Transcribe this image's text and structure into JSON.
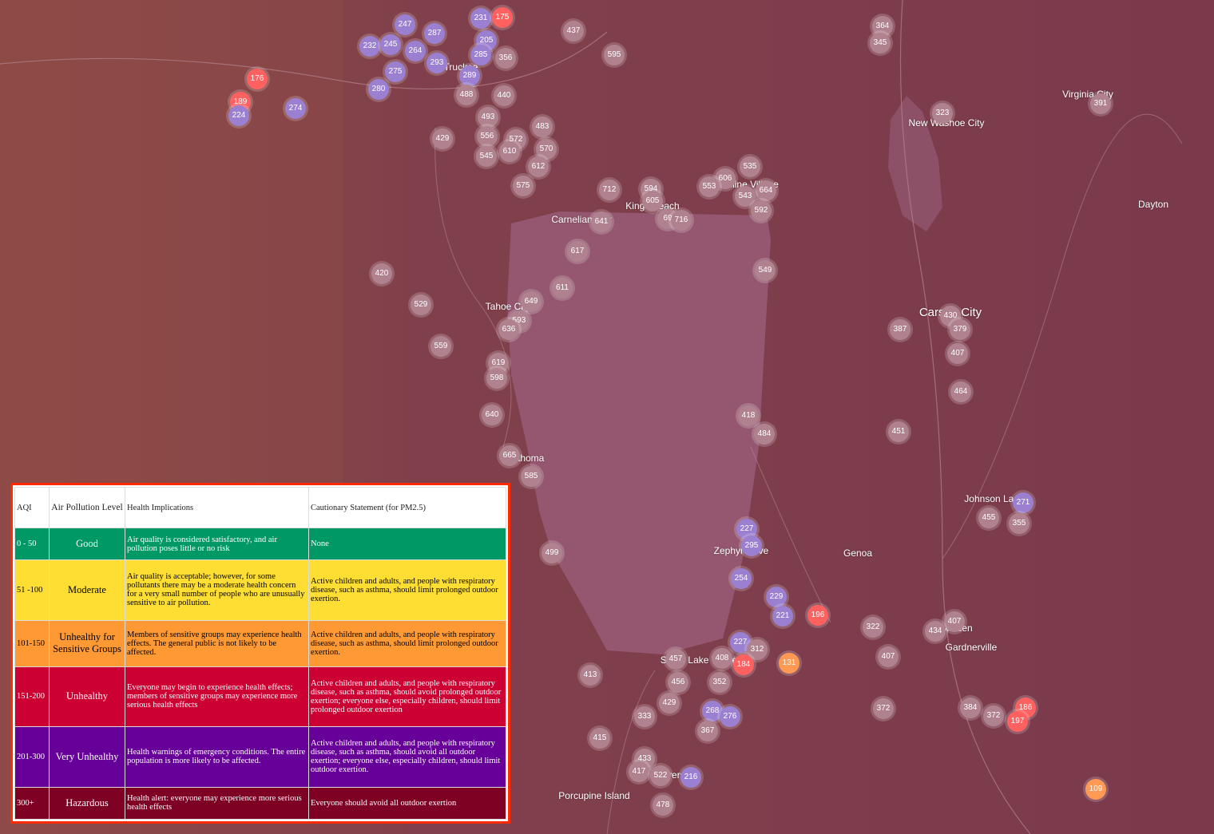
{
  "colors": {
    "bg": "#7a3a4c",
    "lake": "#94576f",
    "purple": "#9b7fd0",
    "mauve": "#b0828f",
    "red": "#ff6060",
    "orange": "#ff9a55"
  },
  "places": [
    {
      "label": "Truckee"
    },
    {
      "label": "Carnelian Bay"
    },
    {
      "label": "Kings Beach"
    },
    {
      "label": "Incline Village"
    },
    {
      "label": "Tahoe City"
    },
    {
      "label": "Tahoma"
    },
    {
      "label": "Zephyr Cove"
    },
    {
      "label": "South Lake Tahoe"
    },
    {
      "label": "Porcupine Island"
    },
    {
      "label": "Genoa"
    },
    {
      "label": "Gardnerville"
    },
    {
      "label": "Johnson Lane"
    },
    {
      "label": "Carson City"
    },
    {
      "label": "New Washoe City"
    },
    {
      "label": "Virginia City"
    },
    {
      "label": "Dayton"
    },
    {
      "label": "Minden"
    },
    {
      "label": "Meyers"
    }
  ],
  "markers": [
    {
      "v": "231",
      "c": "purple"
    },
    {
      "v": "175",
      "c": "red"
    },
    {
      "v": "247",
      "c": "purple"
    },
    {
      "v": "287",
      "c": "purple"
    },
    {
      "v": "205",
      "c": "purple"
    },
    {
      "v": "232",
      "c": "purple"
    },
    {
      "v": "245",
      "c": "purple"
    },
    {
      "v": "264",
      "c": "purple"
    },
    {
      "v": "293",
      "c": "purple"
    },
    {
      "v": "285",
      "c": "purple"
    },
    {
      "v": "356",
      "c": "mauve"
    },
    {
      "v": "437",
      "c": "mauve"
    },
    {
      "v": "595",
      "c": "mauve"
    },
    {
      "v": "275",
      "c": "purple"
    },
    {
      "v": "289",
      "c": "purple"
    },
    {
      "v": "176",
      "c": "red"
    },
    {
      "v": "280",
      "c": "purple"
    },
    {
      "v": "488",
      "c": "mauve"
    },
    {
      "v": "440",
      "c": "mauve"
    },
    {
      "v": "189",
      "c": "red"
    },
    {
      "v": "274",
      "c": "purple"
    },
    {
      "v": "224",
      "c": "purple"
    },
    {
      "v": "493",
      "c": "mauve"
    },
    {
      "v": "483",
      "c": "mauve"
    },
    {
      "v": "556",
      "c": "mauve"
    },
    {
      "v": "572",
      "c": "mauve"
    },
    {
      "v": "429",
      "c": "mauve"
    },
    {
      "v": "570",
      "c": "mauve"
    },
    {
      "v": "610",
      "c": "mauve"
    },
    {
      "v": "545",
      "c": "mauve"
    },
    {
      "v": "612",
      "c": "mauve"
    },
    {
      "v": "575",
      "c": "mauve"
    },
    {
      "v": "364",
      "c": "mauve"
    },
    {
      "v": "345",
      "c": "mauve"
    },
    {
      "v": "323",
      "c": "mauve"
    },
    {
      "v": "391",
      "c": "mauve"
    },
    {
      "v": "535",
      "c": "mauve"
    },
    {
      "v": "606",
      "c": "mauve"
    },
    {
      "v": "553",
      "c": "mauve"
    },
    {
      "v": "664",
      "c": "mauve"
    },
    {
      "v": "543",
      "c": "mauve"
    },
    {
      "v": "592",
      "c": "mauve"
    },
    {
      "v": "712",
      "c": "mauve"
    },
    {
      "v": "594",
      "c": "mauve"
    },
    {
      "v": "605",
      "c": "mauve"
    },
    {
      "v": "69",
      "c": "mauve"
    },
    {
      "v": "716",
      "c": "mauve"
    },
    {
      "v": "641",
      "c": "mauve"
    },
    {
      "v": "617",
      "c": "mauve"
    },
    {
      "v": "549",
      "c": "mauve"
    },
    {
      "v": "420",
      "c": "mauve"
    },
    {
      "v": "611",
      "c": "mauve"
    },
    {
      "v": "529",
      "c": "mauve"
    },
    {
      "v": "649",
      "c": "mauve"
    },
    {
      "v": "593",
      "c": "mauve"
    },
    {
      "v": "636",
      "c": "mauve"
    },
    {
      "v": "387",
      "c": "mauve"
    },
    {
      "v": "430",
      "c": "mauve"
    },
    {
      "v": "379",
      "c": "mauve"
    },
    {
      "v": "559",
      "c": "mauve"
    },
    {
      "v": "407",
      "c": "mauve"
    },
    {
      "v": "619",
      "c": "mauve"
    },
    {
      "v": "598",
      "c": "mauve"
    },
    {
      "v": "464",
      "c": "mauve"
    },
    {
      "v": "640",
      "c": "mauve"
    },
    {
      "v": "418",
      "c": "mauve"
    },
    {
      "v": "484",
      "c": "mauve"
    },
    {
      "v": "451",
      "c": "mauve"
    },
    {
      "v": "665",
      "c": "mauve"
    },
    {
      "v": "585",
      "c": "mauve"
    },
    {
      "v": "271",
      "c": "purple"
    },
    {
      "v": "455",
      "c": "mauve"
    },
    {
      "v": "355",
      "c": "mauve"
    },
    {
      "v": "227",
      "c": "purple"
    },
    {
      "v": "295",
      "c": "purple"
    },
    {
      "v": "499",
      "c": "mauve"
    },
    {
      "v": "254",
      "c": "purple"
    },
    {
      "v": "229",
      "c": "purple"
    },
    {
      "v": "221",
      "c": "purple"
    },
    {
      "v": "196",
      "c": "red"
    },
    {
      "v": "322",
      "c": "mauve"
    },
    {
      "v": "407",
      "c": "mauve"
    },
    {
      "v": "434",
      "c": "mauve"
    },
    {
      "v": "227",
      "c": "purple"
    },
    {
      "v": "312",
      "c": "mauve"
    },
    {
      "v": "457",
      "c": "mauve"
    },
    {
      "v": "408",
      "c": "mauve"
    },
    {
      "v": "184",
      "c": "red"
    },
    {
      "v": "131",
      "c": "orange"
    },
    {
      "v": "407",
      "c": "mauve"
    },
    {
      "v": "413",
      "c": "mauve"
    },
    {
      "v": "456",
      "c": "mauve"
    },
    {
      "v": "352",
      "c": "mauve"
    },
    {
      "v": "429",
      "c": "mauve"
    },
    {
      "v": "268",
      "c": "purple"
    },
    {
      "v": "276",
      "c": "purple"
    },
    {
      "v": "372",
      "c": "mauve"
    },
    {
      "v": "384",
      "c": "mauve"
    },
    {
      "v": "372",
      "c": "mauve"
    },
    {
      "v": "186",
      "c": "red"
    },
    {
      "v": "197",
      "c": "red"
    },
    {
      "v": "333",
      "c": "mauve"
    },
    {
      "v": "367",
      "c": "mauve"
    },
    {
      "v": "415",
      "c": "mauve"
    },
    {
      "v": "433",
      "c": "mauve"
    },
    {
      "v": "417",
      "c": "mauve"
    },
    {
      "v": "522",
      "c": "mauve"
    },
    {
      "v": "216",
      "c": "purple"
    },
    {
      "v": "478",
      "c": "mauve"
    },
    {
      "v": "109",
      "c": "orange"
    }
  ],
  "legend": {
    "headers": [
      "AQI",
      "Air Pollution Level",
      "Health Implications",
      "Cautionary Statement (for PM2.5)"
    ],
    "rows": [
      {
        "range": "0 - 50",
        "level": "Good",
        "health": "Air quality is considered satisfactory, and air pollution poses little or no risk",
        "caution": "None",
        "bg": "#009966",
        "fg": "#ffffff"
      },
      {
        "range": "51 -100",
        "level": "Moderate",
        "health": "Air quality is acceptable; however, for some pollutants there may be a moderate health concern for a very small number of people who are unusually sensitive to air pollution.",
        "caution": "Active children and adults, and people with respiratory disease, such as asthma, should limit prolonged outdoor exertion.",
        "bg": "#ffde33",
        "fg": "#000000"
      },
      {
        "range": "101-150",
        "level": "Unhealthy for Sensitive Groups",
        "health": "Members of sensitive groups may experience health effects. The general public is not likely to be affected.",
        "caution": "Active children and adults, and people with respiratory disease, such as asthma, should limit prolonged outdoor exertion.",
        "bg": "#ff9933",
        "fg": "#000000"
      },
      {
        "range": "151-200",
        "level": "Unhealthy",
        "health": "Everyone may begin to experience health effects; members of sensitive groups may experience more serious health effects",
        "caution": "Active children and adults, and people with respiratory disease, such as asthma, should avoid prolonged outdoor exertion; everyone else, especially children, should limit prolonged outdoor exertion",
        "bg": "#cc0033",
        "fg": "#ffffff"
      },
      {
        "range": "201-300",
        "level": "Very Unhealthy",
        "health": "Health warnings of emergency conditions. The entire population is more likely to be affected.",
        "caution": "Active children and adults, and people with respiratory disease, such as asthma, should avoid all outdoor exertion; everyone else, especially children, should limit outdoor exertion.",
        "bg": "#660099",
        "fg": "#ffffff"
      },
      {
        "range": "300+",
        "level": "Hazardous",
        "health": "Health alert: everyone may experience more serious health effects",
        "caution": "Everyone should avoid all outdoor exertion",
        "bg": "#7e0023",
        "fg": "#ffffff"
      }
    ]
  }
}
